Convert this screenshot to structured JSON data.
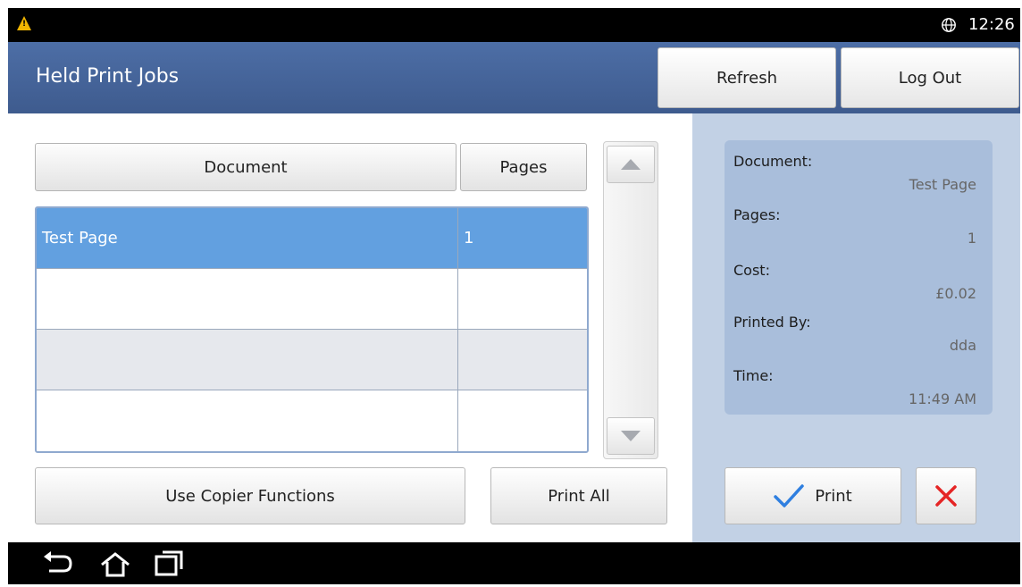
{
  "status_bar": {
    "time": "12:26",
    "warning_icon": "warning-icon",
    "globe_icon": "globe-icon"
  },
  "header": {
    "title": "Held Print Jobs",
    "refresh_label": "Refresh",
    "logout_label": "Log Out"
  },
  "table": {
    "columns": [
      "Document",
      "Pages"
    ],
    "rows": [
      {
        "document": "Test Page",
        "pages": "1",
        "selected": true
      },
      {
        "document": "",
        "pages": ""
      },
      {
        "document": "",
        "pages": ""
      },
      {
        "document": "",
        "pages": ""
      }
    ]
  },
  "details": {
    "document_label": "Document:",
    "document_value": "Test Page",
    "pages_label": "Pages:",
    "pages_value": "1",
    "cost_label": "Cost:",
    "cost_value": "£0.02",
    "printed_by_label": "Printed By:",
    "printed_by_value": "dda",
    "time_label": "Time:",
    "time_value": "11:49 AM"
  },
  "actions": {
    "copier_label": "Use Copier Functions",
    "print_all_label": "Print All",
    "print_label": "Print",
    "print_icon": "checkmark-icon",
    "delete_icon": "delete-x-icon"
  },
  "nav_icons": [
    "back-icon",
    "home-icon",
    "recent-apps-icon"
  ],
  "colors": {
    "header": "#4d6ea6",
    "selected_row": "#62a0e0",
    "details_panel": "#a9bedb",
    "right_panel": "#c2d1e5"
  }
}
